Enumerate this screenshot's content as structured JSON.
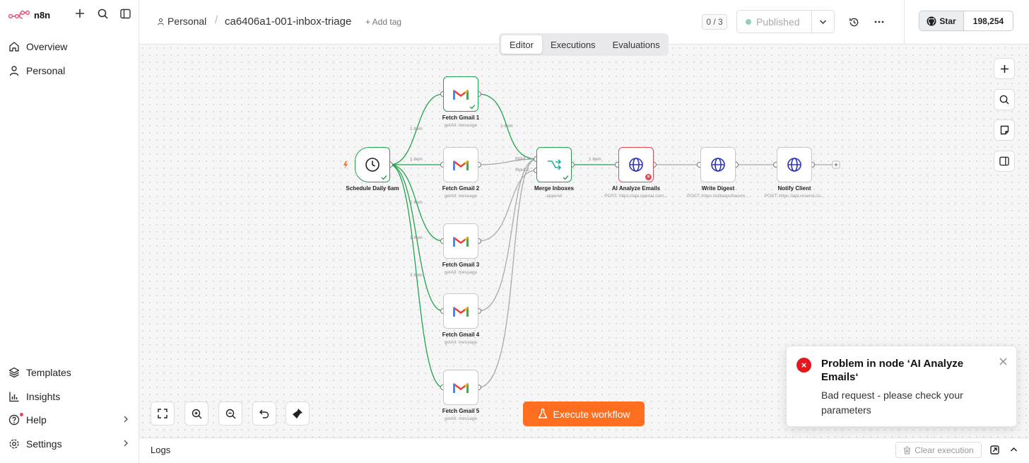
{
  "app": {
    "name": "n8n"
  },
  "sidebar": {
    "top_items": [
      {
        "label": "Overview",
        "icon": "home-icon"
      },
      {
        "label": "Personal",
        "icon": "user-icon"
      }
    ],
    "bottom_items": [
      {
        "label": "Templates",
        "icon": "templates-icon"
      },
      {
        "label": "Insights",
        "icon": "insights-icon"
      },
      {
        "label": "Help",
        "icon": "help-icon"
      },
      {
        "label": "Settings",
        "icon": "gear-icon"
      }
    ]
  },
  "header": {
    "breadcrumb_project": "Personal",
    "breadcrumb_separator": "/",
    "workflow_name": "ca6406a1-001-inbox-triage",
    "add_tag": "+ Add tag",
    "counter": "0 / 3",
    "publish_label": "Published",
    "github_star": "Star",
    "github_count": "198,254"
  },
  "tabs": [
    {
      "label": "Editor",
      "active": true
    },
    {
      "label": "Executions",
      "active": false
    },
    {
      "label": "Evaluations",
      "active": false
    }
  ],
  "nodes": {
    "schedule": {
      "label": "Schedule Daily 6am"
    },
    "gmail1": {
      "label": "Fetch Gmail 1",
      "sub": "getAll: message"
    },
    "gmail2": {
      "label": "Fetch Gmail 2",
      "sub": "getAll: message"
    },
    "gmail3": {
      "label": "Fetch Gmail 3",
      "sub": "getAll: message"
    },
    "gmail4": {
      "label": "Fetch Gmail 4",
      "sub": "getAll: message"
    },
    "gmail5": {
      "label": "Fetch Gmail 5",
      "sub": "getAll: message"
    },
    "merge": {
      "label": "Merge Inboxes",
      "sub": "append"
    },
    "ai": {
      "label": "AI Analyze Emails",
      "sub": "POST: https://api.openai.com..."
    },
    "digest": {
      "label": "Write Digest",
      "sub": "POST: https://xiibaqrofiaovm..."
    },
    "notify": {
      "label": "Notify Client",
      "sub": "POST: https://api.resend.co..."
    }
  },
  "wire_labels": {
    "item": "1 item",
    "input1": "Input 1",
    "input2": "Input 2"
  },
  "execute_label": "Execute workflow",
  "toast": {
    "title": "Problem in node ‘AI Analyze Emails‘",
    "message": "Bad request - please check your parameters"
  },
  "logs": {
    "title": "Logs",
    "clear_label": "Clear execution"
  },
  "colors": {
    "accent": "#ff6d1f",
    "success": "#21a44b",
    "error": "#e5484d"
  }
}
